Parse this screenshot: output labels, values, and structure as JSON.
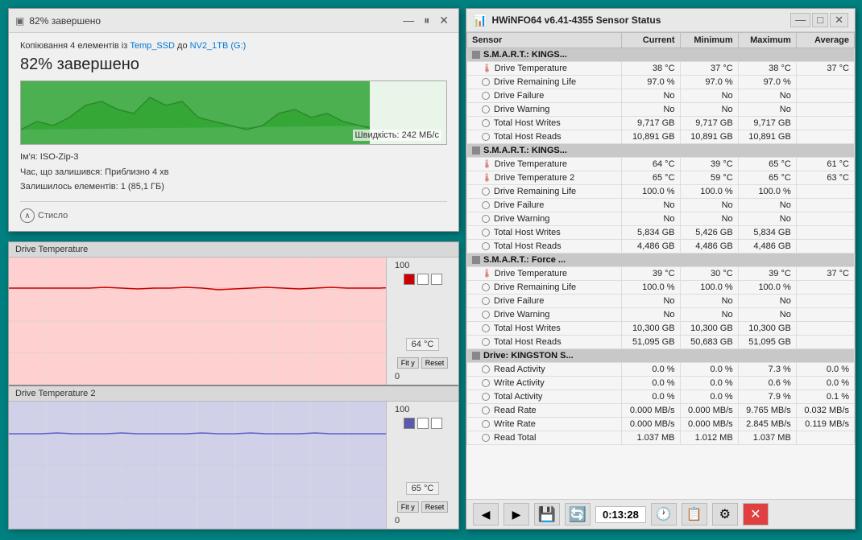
{
  "copy_window": {
    "title": "82% завершено",
    "subtitle_prefix": "Копіювання 4 елементів із ",
    "source": "Temp_SSD",
    "dest_prefix": " до ",
    "dest": "NV2_1TB (G:)",
    "progress_text": "82% завершено",
    "progress_pct": 82,
    "speed": "Швидкість: 242 МБ/с",
    "name_label": "Ім'я:",
    "name_value": "ISO-Zip-3",
    "time_label": "Час, що залишився:",
    "time_value": "Приблизно 4 хв",
    "items_label": "Залишилось елементів:",
    "items_value": "1 (85,1 ГБ)",
    "collapse_btn": "Стисло",
    "pause_btn": "⏸",
    "close_btn": "✕"
  },
  "hwinfo_window": {
    "title": "HWiNFO64 v6.41-4355 Sensor Status",
    "columns": {
      "sensor": "Sensor",
      "current": "Current",
      "minimum": "Minimum",
      "maximum": "Maximum",
      "average": "Average"
    },
    "groups": [
      {
        "id": "group1",
        "header": "S.M.A.R.T.: KINGS...",
        "rows": [
          {
            "name": "Drive Temperature",
            "icon": "temp",
            "current": "38 °C",
            "minimum": "37 °C",
            "maximum": "38 °C",
            "average": "37 °C"
          },
          {
            "name": "Drive Remaining Life",
            "icon": "circle",
            "current": "97.0 %",
            "minimum": "97.0 %",
            "maximum": "97.0 %",
            "average": ""
          },
          {
            "name": "Drive Failure",
            "icon": "circle",
            "current": "No",
            "minimum": "No",
            "maximum": "No",
            "average": ""
          },
          {
            "name": "Drive Warning",
            "icon": "circle",
            "current": "No",
            "minimum": "No",
            "maximum": "No",
            "average": ""
          },
          {
            "name": "Total Host Writes",
            "icon": "circle",
            "current": "9,717 GB",
            "minimum": "9,717 GB",
            "maximum": "9,717 GB",
            "average": ""
          },
          {
            "name": "Total Host Reads",
            "icon": "circle",
            "current": "10,891 GB",
            "minimum": "10,891 GB",
            "maximum": "10,891 GB",
            "average": ""
          }
        ]
      },
      {
        "id": "group2",
        "header": "S.M.A.R.T.: KINGS...",
        "rows": [
          {
            "name": "Drive Temperature",
            "icon": "temp",
            "current": "64 °C",
            "minimum": "39 °C",
            "maximum": "65 °C",
            "average": "61 °C"
          },
          {
            "name": "Drive Temperature 2",
            "icon": "temp",
            "current": "65 °C",
            "minimum": "59 °C",
            "maximum": "65 °C",
            "average": "63 °C"
          },
          {
            "name": "Drive Remaining Life",
            "icon": "circle",
            "current": "100.0 %",
            "minimum": "100.0 %",
            "maximum": "100.0 %",
            "average": ""
          },
          {
            "name": "Drive Failure",
            "icon": "circle",
            "current": "No",
            "minimum": "No",
            "maximum": "No",
            "average": ""
          },
          {
            "name": "Drive Warning",
            "icon": "circle",
            "current": "No",
            "minimum": "No",
            "maximum": "No",
            "average": ""
          },
          {
            "name": "Total Host Writes",
            "icon": "circle",
            "current": "5,834 GB",
            "minimum": "5,426 GB",
            "maximum": "5,834 GB",
            "average": ""
          },
          {
            "name": "Total Host Reads",
            "icon": "circle",
            "current": "4,486 GB",
            "minimum": "4,486 GB",
            "maximum": "4,486 GB",
            "average": ""
          }
        ]
      },
      {
        "id": "group3",
        "header": "S.M.A.R.T.: Force ...",
        "rows": [
          {
            "name": "Drive Temperature",
            "icon": "temp",
            "current": "39 °C",
            "minimum": "30 °C",
            "maximum": "39 °C",
            "average": "37 °C"
          },
          {
            "name": "Drive Remaining Life",
            "icon": "circle",
            "current": "100.0 %",
            "minimum": "100.0 %",
            "maximum": "100.0 %",
            "average": ""
          },
          {
            "name": "Drive Failure",
            "icon": "circle",
            "current": "No",
            "minimum": "No",
            "maximum": "No",
            "average": ""
          },
          {
            "name": "Drive Warning",
            "icon": "circle",
            "current": "No",
            "minimum": "No",
            "maximum": "No",
            "average": ""
          },
          {
            "name": "Total Host Writes",
            "icon": "circle",
            "current": "10,300 GB",
            "minimum": "10,300 GB",
            "maximum": "10,300 GB",
            "average": ""
          },
          {
            "name": "Total Host Reads",
            "icon": "circle",
            "current": "51,095 GB",
            "minimum": "50,683 GB",
            "maximum": "51,095 GB",
            "average": ""
          }
        ]
      },
      {
        "id": "group4",
        "header": "Drive: KINGSTON S...",
        "rows": [
          {
            "name": "Read Activity",
            "icon": "circle",
            "current": "0.0 %",
            "minimum": "0.0 %",
            "maximum": "7.3 %",
            "average": "0.0 %"
          },
          {
            "name": "Write Activity",
            "icon": "circle",
            "current": "0.0 %",
            "minimum": "0.0 %",
            "maximum": "0.6 %",
            "average": "0.0 %"
          },
          {
            "name": "Total Activity",
            "icon": "circle",
            "current": "0.0 %",
            "minimum": "0.0 %",
            "maximum": "7.9 %",
            "average": "0.1 %"
          },
          {
            "name": "Read Rate",
            "icon": "circle",
            "current": "0.000 MB/s",
            "minimum": "0.000 MB/s",
            "maximum": "9.765 MB/s",
            "average": "0.032 MB/s"
          },
          {
            "name": "Write Rate",
            "icon": "circle",
            "current": "0.000 MB/s",
            "minimum": "0.000 MB/s",
            "maximum": "2.845 MB/s",
            "average": "0.119 MB/s"
          },
          {
            "name": "Read Total",
            "icon": "circle",
            "current": "1.037 MB",
            "minimum": "1.012 MB",
            "maximum": "1.037 MB",
            "average": ""
          }
        ]
      }
    ],
    "bottom_bar": {
      "time": "0:13:28",
      "nav_left": "◀",
      "nav_right": "▶",
      "btn1": "💾",
      "btn2": "🔄",
      "btn3": "⚙",
      "btn_close": "✕"
    }
  },
  "drive_temp_graph": {
    "title": "Drive Temperature",
    "max_val": "100",
    "current_val": "64 °C",
    "min_val": "0",
    "fit_label": "Fit y",
    "reset_label": "Reset"
  },
  "drive_temp2_graph": {
    "title": "Drive Temperature 2",
    "max_val": "100",
    "current_val": "65 °C",
    "min_val": "0",
    "fit_label": "Fit y",
    "reset_label": "Reset"
  }
}
